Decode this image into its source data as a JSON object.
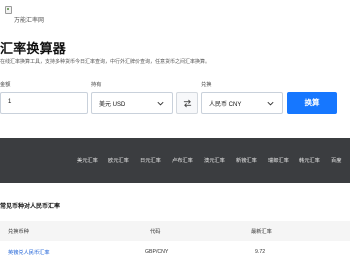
{
  "header": {
    "logo_alt": "万能汇率网"
  },
  "converter": {
    "title": "汇率换算器",
    "subtitle": "在线汇率换算工具，支持多种货币今日汇率查询，中行外汇牌价查询，任意货币之间汇率换算。",
    "amount_label": "金额",
    "amount_value": "1",
    "from_label": "持有",
    "from_value": "美元 USD",
    "to_label": "兑换",
    "to_value": "人民币 CNY",
    "submit_label": "换算"
  },
  "nav": {
    "items": [
      "美元汇率",
      "欧元汇率",
      "日元汇率",
      "卢布汇率",
      "澳元汇率",
      "新镑汇率",
      "瑞郎汇率",
      "韩元汇率",
      "百度"
    ]
  },
  "table": {
    "section_title": "常见币种对人民币汇率",
    "headers": [
      "兑换币种",
      "代码",
      "最新汇率"
    ],
    "rows": [
      {
        "name": "英镑兑人民币汇率",
        "code": "GBP/CNY",
        "rate": "9.72"
      }
    ]
  },
  "colors": {
    "accent": "#1677ff",
    "nav_bg": "#3b3d40",
    "link": "#1a5fd6"
  }
}
